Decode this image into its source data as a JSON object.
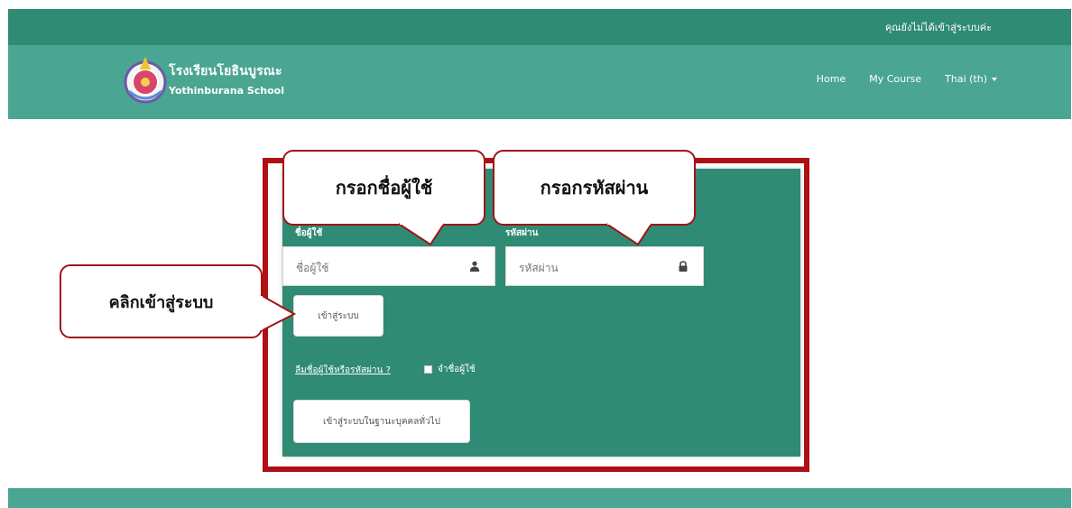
{
  "top_bar": {
    "login_status": "คุณยังไม่ได้เข้าสู่ระบบค่ะ"
  },
  "brand": {
    "name_th": "โรงเรียนโยธินบูรณะ",
    "name_en": "Yothinburana School"
  },
  "nav": {
    "home": "Home",
    "my_course": "My Course",
    "language": "Thai (th)"
  },
  "login_form": {
    "username_label": "ชื่อผู้ใช้",
    "username_placeholder": "ชื่อผู้ใช้",
    "password_label": "รหัสผ่าน",
    "password_placeholder": "รหัสผ่าน",
    "login_button": "เข้าสู่ระบบ",
    "forgot_link": "ลืมชื่อผู้ใช้หรือรหัสผ่าน ?",
    "remember_label": "จำชื่อผู้ใช้",
    "guest_button": "เข้าสู่ระบบในฐานะบุคคลทั่วไป"
  },
  "callouts": {
    "username": "กรอกชื่อผู้ใช้",
    "password": "กรอกรหัสผ่าน",
    "login": "คลิกเข้าสู่ระบบ"
  },
  "colors": {
    "topbar": "#2f8b73",
    "navbar": "#4aa692",
    "panel": "#2f8b73",
    "highlight_border": "#b01015",
    "callout_border": "#a01416"
  }
}
